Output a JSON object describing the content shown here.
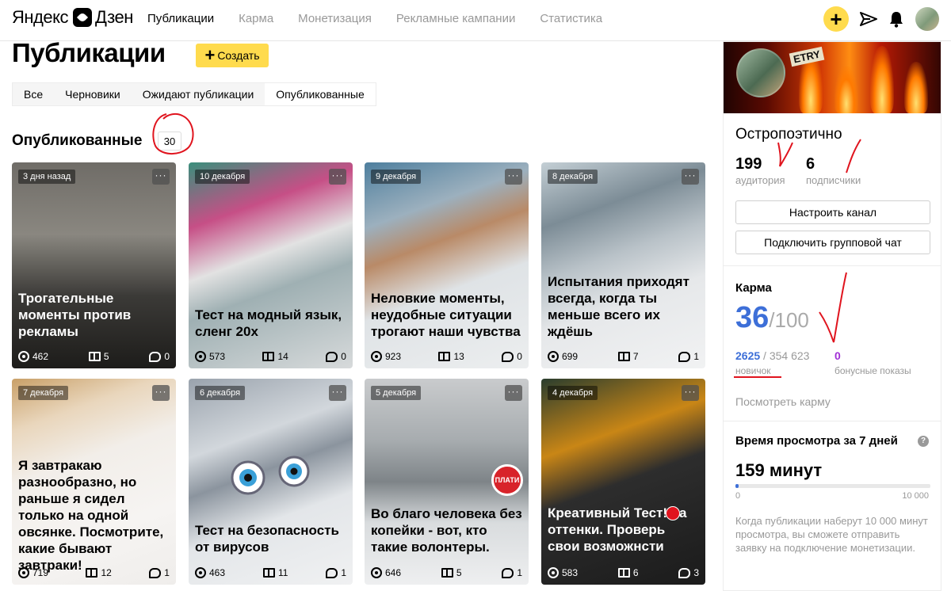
{
  "header": {
    "logo_left": "Яндекс",
    "logo_right": "Дзен",
    "nav": [
      {
        "label": "Публикации",
        "active": true
      },
      {
        "label": "Карма",
        "active": false
      },
      {
        "label": "Монетизация",
        "active": false
      },
      {
        "label": "Рекламные кампании",
        "active": false
      },
      {
        "label": "Статистика",
        "active": false
      }
    ],
    "icons": [
      "plus-icon",
      "send-icon",
      "bell-icon",
      "avatar"
    ]
  },
  "page": {
    "title": "Публикации",
    "create_label": "Создать",
    "tabs": [
      {
        "label": "Все",
        "selected": false
      },
      {
        "label": "Черновики",
        "selected": false
      },
      {
        "label": "Ожидают публикации",
        "selected": false
      },
      {
        "label": "Опубликованные",
        "selected": true
      }
    ],
    "section_title": "Опубликованные",
    "section_count": "30"
  },
  "cards": [
    {
      "date": "3 дня назад",
      "title": "Трогательные моменты против рекламы",
      "views": "462",
      "reads": "5",
      "comments": "0"
    },
    {
      "date": "10 декабря",
      "title": "Тест на модный язык, сленг 20х",
      "views": "573",
      "reads": "14",
      "comments": "0"
    },
    {
      "date": "9 декабря",
      "title": "Неловкие моменты, неудобные ситуации трогают наши чувства",
      "views": "923",
      "reads": "13",
      "comments": "0"
    },
    {
      "date": "8 декабря",
      "title": "Испытания приходят всегда, когда ты меньше всего их ждёшь",
      "views": "699",
      "reads": "7",
      "comments": "1"
    },
    {
      "date": "7 декабря",
      "title": "Я завтракаю разнообразно, но раньше я сидел только на одной овсянке. Посмотрите, какие бывают завтраки!",
      "views": "719",
      "reads": "12",
      "comments": "1"
    },
    {
      "date": "6 декабря",
      "title": "Тест на безопасность от вирусов",
      "views": "463",
      "reads": "11",
      "comments": "1"
    },
    {
      "date": "5 декабря",
      "title": "Во благо человека без копейки - вот, кто такие волонтеры.",
      "views": "646",
      "reads": "5",
      "comments": "1",
      "badge": "ПЛАТИ"
    },
    {
      "date": "4 декабря",
      "title": "Креативный Тест! на оттенки. Проверь свои возможнсти",
      "views": "583",
      "reads": "6",
      "comments": "3"
    }
  ],
  "channel": {
    "cover_text": "ETRY",
    "name": "Остропоэтично",
    "audience": "199",
    "audience_label": "аудитория",
    "subscribers": "6",
    "subscribers_label": "подписчики",
    "setup_button": "Настроить канал",
    "group_chat_button": "Подключить групповой чат"
  },
  "karma": {
    "heading": "Карма",
    "value": "36",
    "max": "/100",
    "rank_value": "2625",
    "rank_total": " / 354 623",
    "rank_label": "новичок",
    "bonus_value": "0",
    "bonus_label": "бонусные показы",
    "link": "Посмотреть карму"
  },
  "watch_time": {
    "heading": "Время просмотра за 7 дней",
    "value": "159 минут",
    "progress_fraction": 0.0159,
    "min_label": "0",
    "max_label": "10 000",
    "note": "Когда публикации наберут 10 000 минут просмотра, вы сможете отправить заявку на подключение монетизации."
  },
  "colors": {
    "accent_yellow": "#ffdb4d",
    "karma_blue": "#3d6fd8",
    "bonus_purple": "#a12fd6",
    "annotation_red": "#e0141e"
  }
}
